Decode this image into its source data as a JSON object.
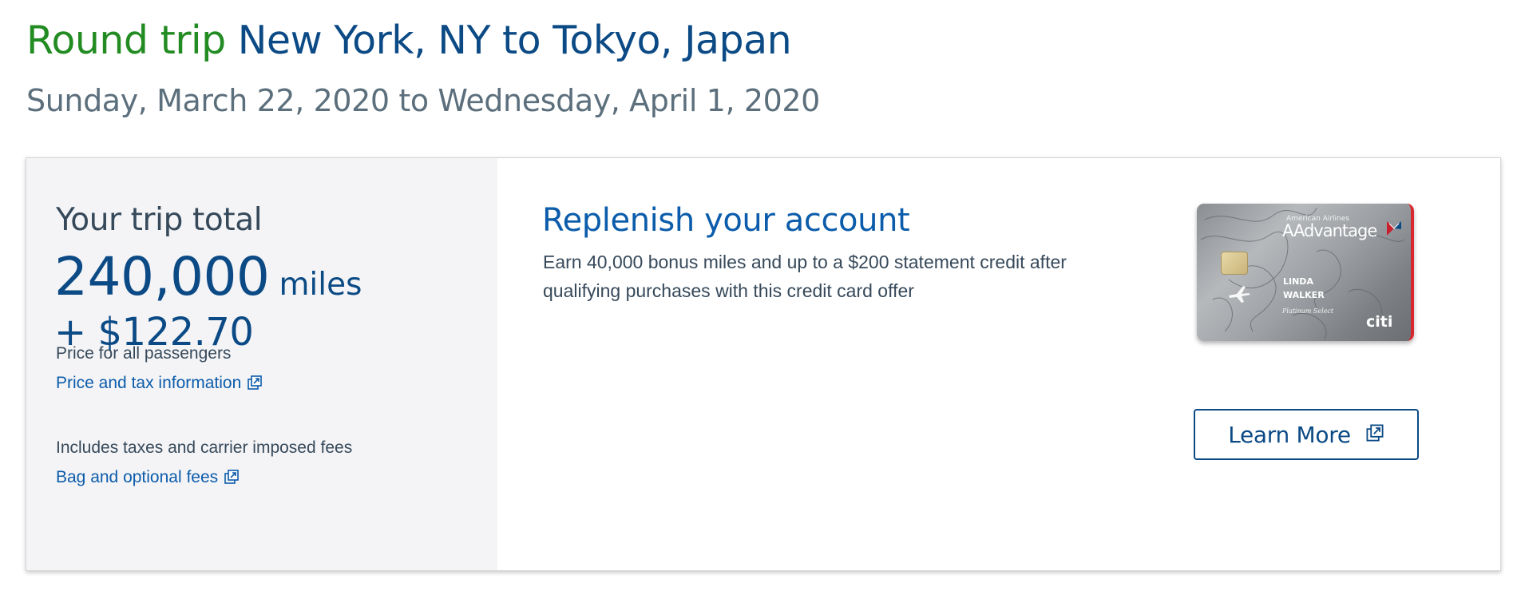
{
  "header": {
    "trip_type": "Round trip",
    "route": "New York, NY to Tokyo, Japan",
    "dates": "Sunday, March 22, 2020 to Wednesday, April 1, 2020"
  },
  "summary": {
    "label": "Your trip total",
    "miles_amount": "240,000",
    "miles_unit": "miles",
    "cash": "+ $122.70",
    "price_note": "Price for all passengers",
    "price_link": "Price and tax information",
    "fees_note": "Includes taxes and carrier imposed fees",
    "fees_link": "Bag and optional fees"
  },
  "promo": {
    "title": "Replenish your account",
    "body": "Earn 40,000 bonus miles and up to a $200 statement credit after qualifying purchases with this credit card offer",
    "card": {
      "brand_small": "American Airlines",
      "brand": "AAdvantage",
      "cardholder": "LINDA\nWALKER",
      "tier": "Platinum Select",
      "issuer": "citi"
    },
    "button_label": "Learn More"
  },
  "colors": {
    "green": "#228b22",
    "navy": "#0b4a85",
    "link_blue": "#0b5cab",
    "gray_text": "#5c6f7c",
    "panel_bg": "#f4f4f6",
    "card_accent": "#d8272f"
  },
  "icons": {
    "external_link": "external-link-icon",
    "plane": "plane-icon",
    "flag": "flag-icon"
  }
}
